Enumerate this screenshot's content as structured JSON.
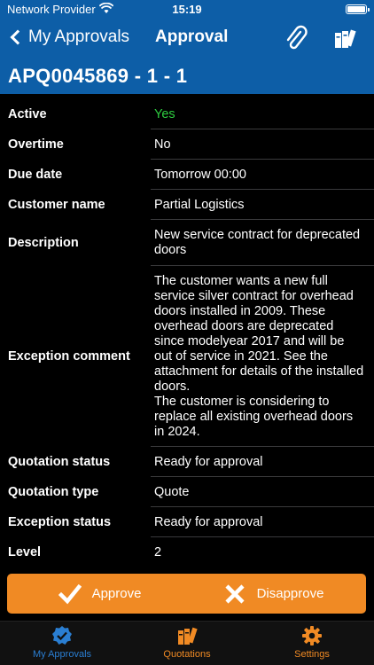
{
  "status_bar": {
    "carrier": "Network Provider",
    "time": "15:19"
  },
  "nav": {
    "back_label": "My Approvals",
    "title": "Approval"
  },
  "record": {
    "title": "APQ0045869 - 1 - 1",
    "fields": [
      {
        "label": "Active",
        "value": "Yes"
      },
      {
        "label": "Overtime",
        "value": "No"
      },
      {
        "label": "Due date",
        "value": "Tomorrow 00:00"
      },
      {
        "label": "Customer name",
        "value": "Partial Logistics"
      },
      {
        "label": "Description",
        "value": "New service contract for deprecated doors"
      },
      {
        "label": "Exception comment",
        "value": "The customer wants a new full service silver contract for overhead doors installed in 2009. These overhead doors are deprecated since modelyear 2017 and will be out of service in 2021. See the attachment for details of the installed doors.\nThe customer is considering to replace all existing overhead doors in 2024."
      },
      {
        "label": "Quotation status",
        "value": "Ready for approval"
      },
      {
        "label": "Quotation type",
        "value": "Quote"
      },
      {
        "label": "Exception status",
        "value": "Ready for approval"
      },
      {
        "label": "Level",
        "value": "2"
      }
    ]
  },
  "actions": {
    "approve": "Approve",
    "disapprove": "Disapprove"
  },
  "tabs": [
    {
      "label": "My Approvals",
      "icon": "check-badge-icon"
    },
    {
      "label": "Quotations",
      "icon": "books-icon"
    },
    {
      "label": "Settings",
      "icon": "gear-icon"
    }
  ],
  "colors": {
    "header": "#0d5ea7",
    "accent": "#f08a24",
    "active_tab": "#2a7ed2",
    "positive": "#2ecc40"
  }
}
